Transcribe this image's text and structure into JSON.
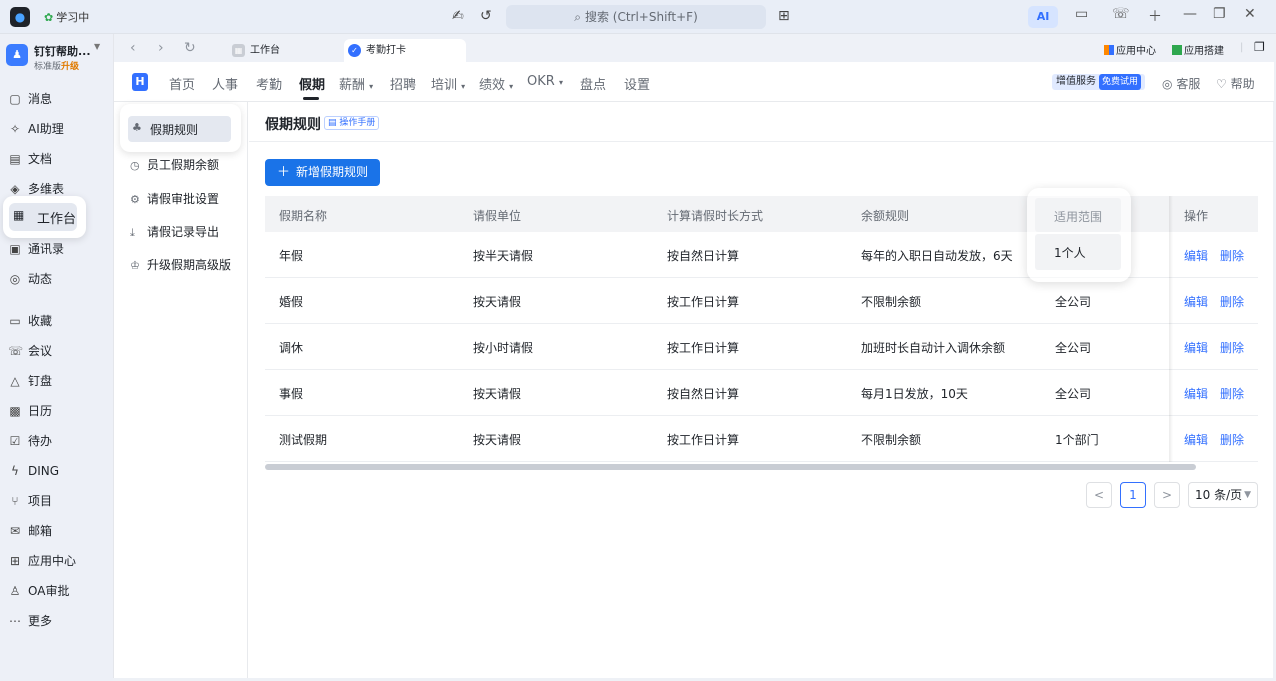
{
  "titlebar": {
    "status": "学习中",
    "search_placeholder": "搜索 (Ctrl+Shift+F)",
    "ai_label": "AI"
  },
  "org": {
    "name": "钉钉帮助...",
    "plan": "标准版",
    "upgrade": "升级"
  },
  "sidebar": {
    "items": [
      {
        "label": "消息",
        "icon": "message-icon"
      },
      {
        "label": "AI助理",
        "icon": "ai-assistant-icon"
      },
      {
        "label": "文档",
        "icon": "doc-icon"
      },
      {
        "label": "多维表",
        "icon": "table-icon"
      },
      {
        "label": "工作台",
        "icon": "workbench-icon"
      },
      {
        "label": "通讯录",
        "icon": "contacts-icon"
      },
      {
        "label": "动态",
        "icon": "feed-icon"
      },
      {
        "label": "收藏",
        "icon": "favorite-icon"
      },
      {
        "label": "会议",
        "icon": "meeting-icon"
      },
      {
        "label": "钉盘",
        "icon": "drive-icon"
      },
      {
        "label": "日历",
        "icon": "calendar-icon"
      },
      {
        "label": "待办",
        "icon": "todo-icon"
      },
      {
        "label": "DING",
        "icon": "ding-icon"
      },
      {
        "label": "项目",
        "icon": "project-icon"
      },
      {
        "label": "邮箱",
        "icon": "mail-icon"
      },
      {
        "label": "应用中心",
        "icon": "app-center-icon"
      },
      {
        "label": "OA审批",
        "icon": "oa-approval-icon"
      },
      {
        "label": "更多",
        "icon": "more-icon"
      }
    ]
  },
  "tabs": [
    {
      "label": "工作台"
    },
    {
      "label": "考勤打卡"
    }
  ],
  "top_links": {
    "app_center": "应用中心",
    "app_build": "应用搭建"
  },
  "appnav": {
    "items": [
      "首页",
      "人事",
      "考勤",
      "假期",
      "薪酬",
      "招聘",
      "培训",
      "绩效",
      "OKR",
      "盘点",
      "设置"
    ],
    "value_added": "增值服务",
    "free_trial": "免费试用",
    "service": "客服",
    "help": "帮助"
  },
  "subnav": {
    "items": [
      "假期规则",
      "员工假期余额",
      "请假审批设置",
      "请假记录导出",
      "升级假期高级版"
    ]
  },
  "page": {
    "title": "假期规则",
    "manual": "操作手册",
    "add_button": "新增假期规则"
  },
  "table": {
    "headers": [
      "假期名称",
      "请假单位",
      "计算请假时长方式",
      "余额规则",
      "适用范围",
      "操作"
    ],
    "rows": [
      [
        "年假",
        "按半天请假",
        "按自然日计算",
        "每年的入职日自动发放，6天",
        "1个人"
      ],
      [
        "婚假",
        "按天请假",
        "按工作日计算",
        "不限制余额",
        "全公司"
      ],
      [
        "调休",
        "按小时请假",
        "按工作日计算",
        "加班时长自动计入调休余额",
        "全公司"
      ],
      [
        "事假",
        "按天请假",
        "按自然日计算",
        "每月1日发放，10天",
        "全公司"
      ],
      [
        "测试假期",
        "按天请假",
        "按工作日计算",
        "不限制余额",
        "1个部门"
      ]
    ],
    "edit": "编辑",
    "delete": "删除"
  },
  "pager": {
    "prev": "<",
    "current": "1",
    "next": ">",
    "page_size": "10 条/页"
  }
}
